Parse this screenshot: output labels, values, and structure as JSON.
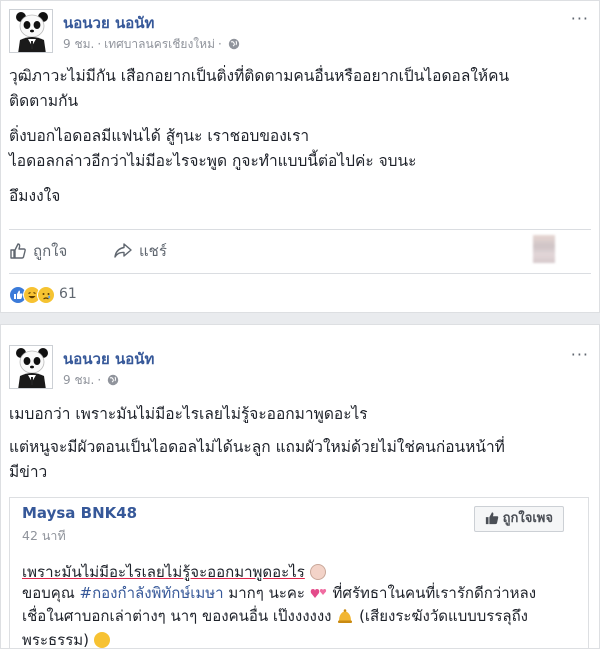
{
  "posts": [
    {
      "author": "นอนวย นอนัท",
      "time": "9 ชม.",
      "location": "เทศบาลนครเชียงใหม่",
      "more": "···",
      "lines": [
        "วุฒิภาวะไม่มีกัน เสือกอยากเป็นติ่งที่ติดตามคนอื่นหรืออยากเป็นไอดอลให้คน",
        "ติดตามกัน",
        "ติ่งบอกไอดอลมีแฟนได้ สู้ๆนะ เราชอบของเรา",
        "ไอดอลกล่าวอีกว่าไม่มีอะไรจะพูด กูจะทำแบบนี้ต่อไปค่ะ จบนะ",
        "อึมงงใจ"
      ],
      "like_label": "ถูกใจ",
      "share_label": "แชร์",
      "reaction_count": "61"
    },
    {
      "author": "นอนวย นอนัท",
      "time": "9 ชม.",
      "more": "···",
      "lines": [
        "เมบอกว่า เพราะมันไม่มีอะไรเลยไม่รู้จะออกมาพูดอะไร",
        "แต่หนูจะมีผัวตอนเป็นไอดอลไม่ได้นะลูก แถมผัวใหม่ด้วยไม่ใช่คนก่อนหน้าที่",
        "มีข่าว"
      ],
      "shared": {
        "page_name": "Maysa BNK48",
        "time": "42 นาที",
        "like_page_label": "ถูกใจเพจ",
        "line1": "เพราะมันไม่มีอะไรเลยไม่รู้จะออกมาพูดอะไร",
        "line2_a": "ขอบคุณ ",
        "line2_hashtag": "#กองกำลังพิทักษ์เมษา",
        "line2_b": " มากๆ นะคะ",
        "line2_c": " ที่ศรัทธาในคนที่เรารักดีกว่าหลง",
        "line3": "เชื่อในศาบอกเล่าต่างๆ นาๆ ของคนอื่น เป๊งงงงงง",
        "line3_b": " (เสียงระฆังวัดแบบบรรลุถึง",
        "line4": "พระธรรม)"
      }
    }
  ],
  "colors": {
    "link": "#365899",
    "meta": "#90949c",
    "like_blue": "#3b7bd9",
    "haha_yellow": "#f7c232"
  },
  "icons": [
    "panda-avatar",
    "globe-icon",
    "thumbs-up-icon",
    "share-arrow-icon",
    "more-options-icon"
  ]
}
